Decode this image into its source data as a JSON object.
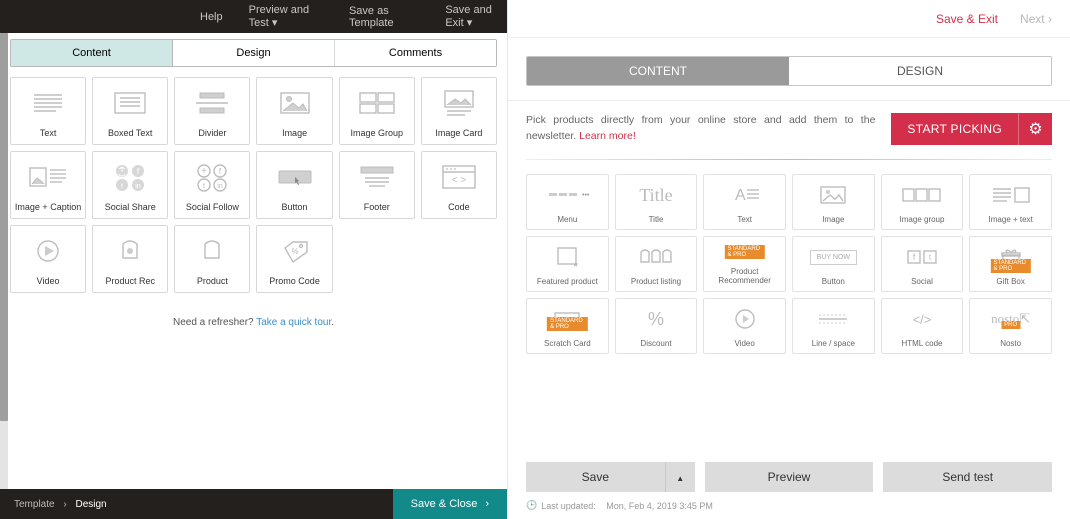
{
  "left": {
    "topmenu": {
      "help": "Help",
      "preview": "Preview and Test",
      "saveTemplate": "Save as Template",
      "saveExit": "Save and Exit"
    },
    "tabs": [
      "Content",
      "Design",
      "Comments"
    ],
    "cards": [
      {
        "id": "text",
        "label": "Text"
      },
      {
        "id": "boxed-text",
        "label": "Boxed Text"
      },
      {
        "id": "divider",
        "label": "Divider"
      },
      {
        "id": "image",
        "label": "Image"
      },
      {
        "id": "image-group",
        "label": "Image Group"
      },
      {
        "id": "image-card",
        "label": "Image Card"
      },
      {
        "id": "image-caption",
        "label": "Image + Caption"
      },
      {
        "id": "social-share",
        "label": "Social Share"
      },
      {
        "id": "social-follow",
        "label": "Social Follow"
      },
      {
        "id": "button",
        "label": "Button"
      },
      {
        "id": "footer",
        "label": "Footer"
      },
      {
        "id": "code",
        "label": "Code"
      },
      {
        "id": "video",
        "label": "Video"
      },
      {
        "id": "product-rec",
        "label": "Product Rec"
      },
      {
        "id": "product",
        "label": "Product"
      },
      {
        "id": "promo-code",
        "label": "Promo Code"
      }
    ],
    "refresher": {
      "prefix": "Need a refresher? ",
      "link": "Take a quick tour"
    },
    "breadcrumb": {
      "root": "Template",
      "current": "Design"
    },
    "saveClose": "Save & Close"
  },
  "right": {
    "topbar": {
      "saveExit": "Save & Exit",
      "next": "Next"
    },
    "tabs": [
      "CONTENT",
      "DESIGN"
    ],
    "pick": {
      "text": "Pick products directly from your online store and add them to the newsletter. ",
      "learn": "Learn more!",
      "button": "START PICKING"
    },
    "cards": [
      {
        "id": "menu",
        "label": "Menu"
      },
      {
        "id": "title",
        "label": "Title"
      },
      {
        "id": "text",
        "label": "Text"
      },
      {
        "id": "image",
        "label": "Image"
      },
      {
        "id": "image-group",
        "label": "Image group"
      },
      {
        "id": "image-text",
        "label": "Image + text"
      },
      {
        "id": "featured-product",
        "label": "Featured product"
      },
      {
        "id": "product-listing",
        "label": "Product listing"
      },
      {
        "id": "product-recommender",
        "label": "Product Recommender",
        "badge": "STANDARD & PRO"
      },
      {
        "id": "button",
        "label": "Button",
        "thumbText": "BUY NOW"
      },
      {
        "id": "social",
        "label": "Social"
      },
      {
        "id": "gift-box",
        "label": "Gift Box",
        "badge": "STANDARD & PRO"
      },
      {
        "id": "scratch-card",
        "label": "Scratch Card",
        "badge": "STANDARD & PRO"
      },
      {
        "id": "discount",
        "label": "Discount"
      },
      {
        "id": "video",
        "label": "Video"
      },
      {
        "id": "line-space",
        "label": "Line / space"
      },
      {
        "id": "html-code",
        "label": "HTML code"
      },
      {
        "id": "nosto",
        "label": "Nosto",
        "badge": "PRO"
      }
    ],
    "footer": {
      "save": "Save",
      "preview": "Preview",
      "sendTest": "Send test",
      "lastUpdatedLabel": "Last updated:",
      "lastUpdatedValue": "Mon, Feb 4, 2019 3:45 PM"
    }
  }
}
